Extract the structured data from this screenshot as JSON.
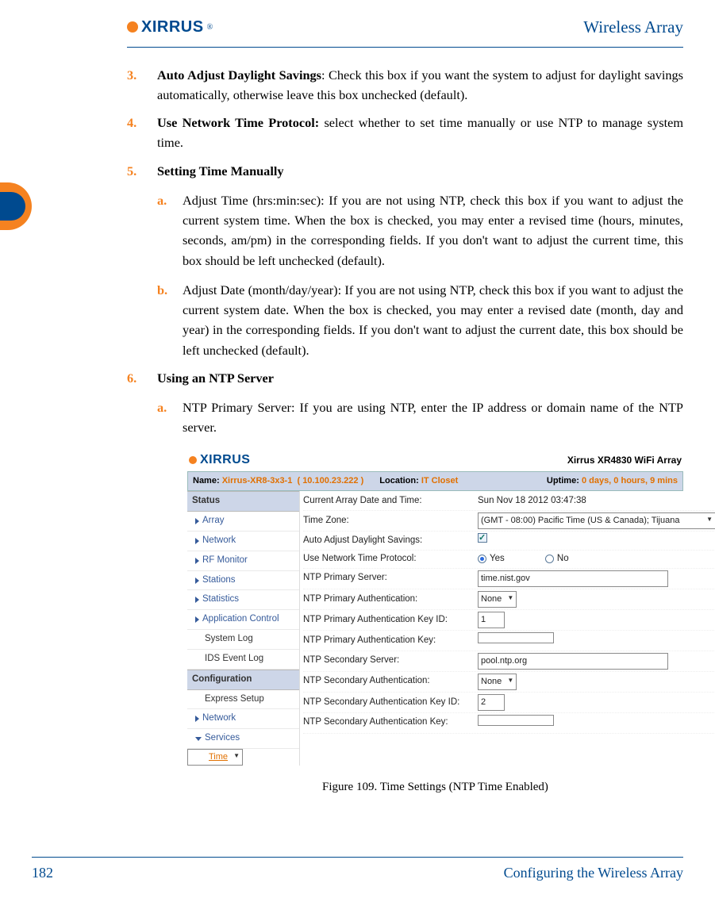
{
  "header": {
    "logo": "XIRRUS",
    "title": "Wireless Array"
  },
  "items": [
    {
      "num": "3.",
      "bold": "Auto Adjust Daylight Savings",
      "sep": ": ",
      "text": "Check this box if you want the system to adjust for daylight savings automatically, otherwise leave this box unchecked (default)."
    },
    {
      "num": "4.",
      "bold": "Use Network Time Protocol:",
      "sep": " ",
      "text": "select whether to set time manually or use NTP to manage system time."
    },
    {
      "num": "5.",
      "bold": "Setting Time Manually",
      "sep": "",
      "text": "",
      "subs": [
        {
          "mark": "a.",
          "bold": "Adjust Time (hrs:min:sec)",
          "sep": ": ",
          "text": "If you are not using NTP, check this box if you want to adjust the current system time. When the box is checked, you may enter a revised time (hours, minutes, seconds, am/pm) in the corresponding fields. If you don't want to adjust the current time, this box should be left unchecked (default)."
        },
        {
          "mark": "b.",
          "bold": "Adjust Date (month/day/year)",
          "sep": ": ",
          "text": "If you are not using NTP, check this box if you want to adjust the current system date. When the box is checked, you may enter a revised date (month, day and year) in the corresponding fields. If you don't want to adjust the current date, this box should be left unchecked (default)."
        }
      ]
    },
    {
      "num": "6.",
      "bold": "Using an NTP Server",
      "sep": "",
      "text": "",
      "subs": [
        {
          "mark": "a.",
          "bold": "NTP Primary Server",
          "sep": ": ",
          "text": "If you are using NTP, enter the IP address or domain name of the NTP server."
        }
      ]
    }
  ],
  "fig": {
    "model": "Xirrus XR4830 WiFi Array",
    "status": {
      "name_lbl": "Name:",
      "name": "Xirrus-XR8-3x3-1",
      "ip": "( 10.100.23.222 )",
      "loc_lbl": "Location:",
      "loc": "IT Closet",
      "up_lbl": "Uptime:",
      "up": "0 days, 0 hours, 9 mins"
    },
    "sidebar": {
      "sec1": "Status",
      "items1": [
        "Array",
        "Network",
        "RF Monitor",
        "Stations",
        "Statistics",
        "Application Control",
        "System Log",
        "IDS Event Log"
      ],
      "sec2": "Configuration",
      "items2": [
        "Express Setup",
        "Network",
        "Services"
      ],
      "sel": "Time"
    },
    "rows": {
      "r0l": "Current Array Date and Time:",
      "r0v": "Sun Nov 18 2012 03:47:38",
      "r1l": "Time Zone:",
      "r1v": "(GMT - 08:00) Pacific Time (US & Canada); Tijuana",
      "r2l": "Auto Adjust Daylight Savings:",
      "r3l": "Use Network Time Protocol:",
      "r3y": "Yes",
      "r3n": "No",
      "r4l": "NTP Primary Server:",
      "r4v": "time.nist.gov",
      "r5l": "NTP Primary Authentication:",
      "r5v": "None",
      "r6l": "NTP Primary Authentication Key ID:",
      "r6v": "1",
      "r7l": "NTP Primary Authentication Key:",
      "r7v": "",
      "r8l": "NTP Secondary Server:",
      "r8v": "pool.ntp.org",
      "r9l": "NTP Secondary Authentication:",
      "r9v": "None",
      "r10l": "NTP Secondary Authentication Key ID:",
      "r10v": "2",
      "r11l": "NTP Secondary Authentication Key:",
      "r11v": ""
    },
    "caption": "Figure 109. Time Settings (NTP Time Enabled)"
  },
  "footer": {
    "page": "182",
    "section": "Configuring the Wireless Array"
  }
}
